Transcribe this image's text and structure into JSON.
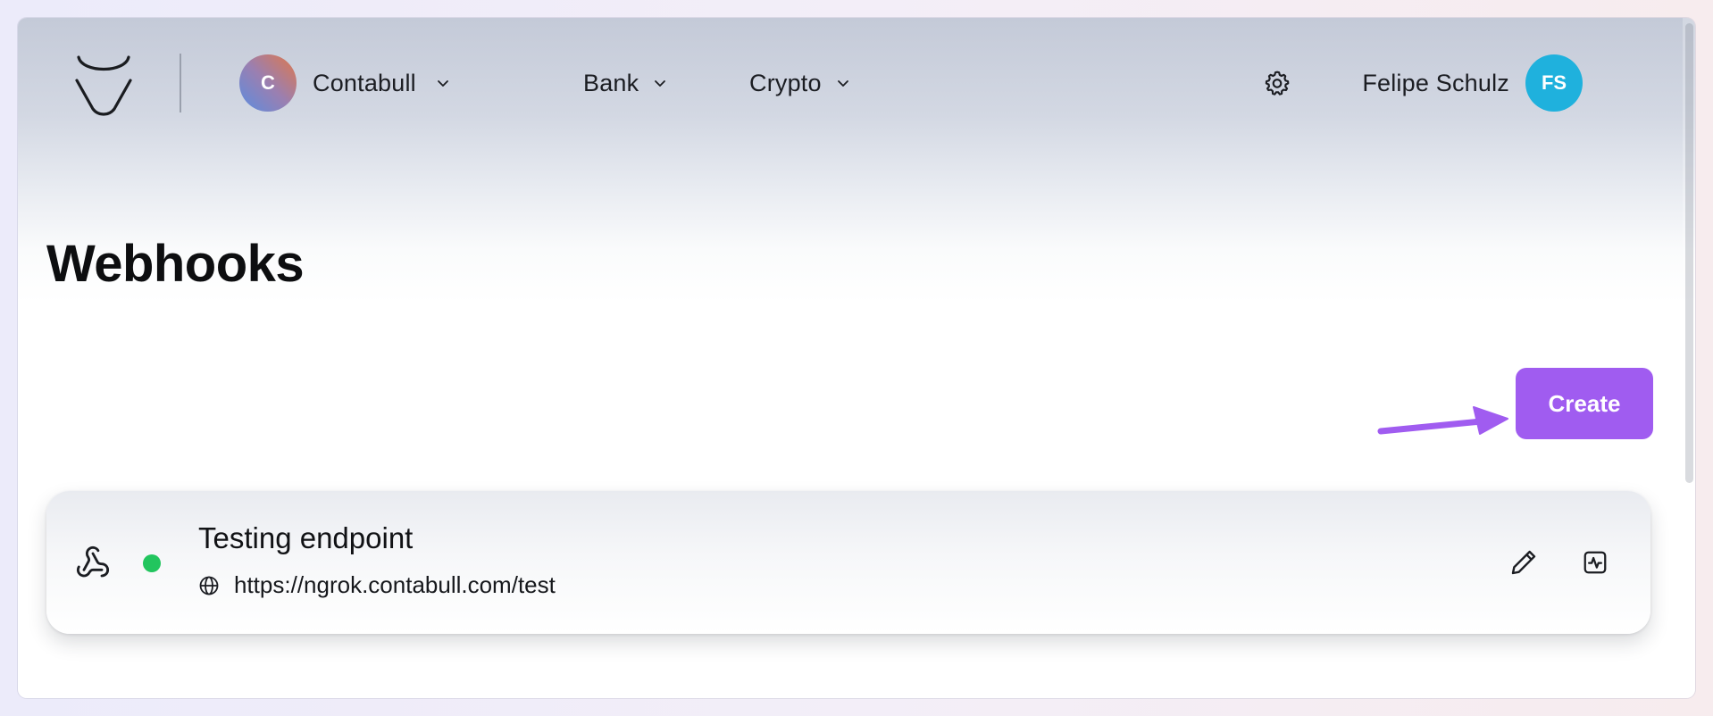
{
  "navbar": {
    "organization": {
      "avatar_initial": "C",
      "name": "Contabull"
    },
    "menus": [
      {
        "label": "Bank"
      },
      {
        "label": "Crypto"
      }
    ],
    "user": {
      "name": "Felipe Schulz",
      "initials": "FS"
    }
  },
  "page": {
    "title": "Webhooks",
    "create_label": "Create"
  },
  "webhooks": [
    {
      "name": "Testing endpoint",
      "url": "https://ngrok.contabull.com/test",
      "status": "active"
    }
  ],
  "colors": {
    "accent": "#a05cf0",
    "status_active": "#22c55e",
    "user_avatar": "#1fb1dd"
  },
  "icons": [
    "logo-icon",
    "chevron-down-icon",
    "settings-gear-icon",
    "webhook-icon",
    "globe-icon",
    "pencil-icon",
    "activity-icon"
  ]
}
